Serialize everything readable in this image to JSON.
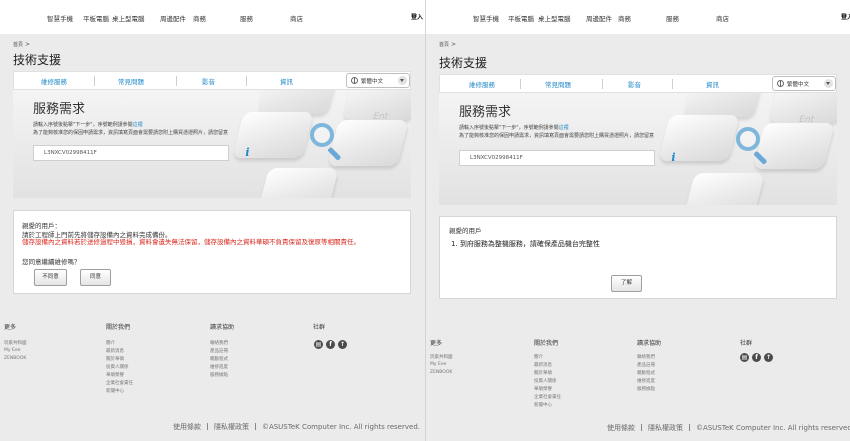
{
  "nav": {
    "items": [
      "智慧手機",
      "平板電腦",
      "桌上型電腦",
      "周邊配件",
      "商務",
      "服務",
      "商店"
    ],
    "login": "登入"
  },
  "breadcrumb": "首頁",
  "page_title": "技術支援",
  "tabs": [
    "維修服務",
    "常見問題",
    "影音",
    "資訊"
  ],
  "language": "繁體中文",
  "hero": {
    "key_label": "Ent",
    "form_title": "服務需求",
    "instruction": "請輸入序號後點擊\"下一步\"，序號範例請參閱",
    "instruction_link": "這裡",
    "note": "為了能夠核准您的保固申請需求，資訊填寫頁面會需要請您附上購買憑證照片，請您留意",
    "serial_value": "L3NXCV02998411F"
  },
  "left_notice": {
    "greeting": "親愛的用戶：",
    "line1": "請於工程師上門前先將儲存設備內之資料完成備份。",
    "warning": "儲存設備內之資料若於送修過程中毀損，資料會遺失無法保留，儲存設備內之資料華碩不負責保留及復原等相關責任。",
    "question": "您同意繼續維修嗎？",
    "disagree": "不同意",
    "agree": "同意"
  },
  "right_notice": {
    "greeting": "親愛的用戶",
    "item": "1.  到府服務為整機服務，請確保產品機台完整性",
    "ok": "了解"
  },
  "footer": {
    "col1": {
      "title": "更多",
      "links": [
        "玩家共和國",
        "My Eee",
        "ZENBOOK"
      ]
    },
    "col2": {
      "title": "關於我們",
      "links": [
        "簡介",
        "最新消息",
        "關於華碩",
        "投資人關係",
        "華碩榮譽",
        "企業社會責任",
        "新聞中心"
      ]
    },
    "col3": {
      "title": "讀求協助",
      "links": [
        "聯絡我們",
        "產品註冊",
        "驅動程式",
        "維修進度",
        "服務據點"
      ]
    },
    "col4": {
      "title": "社群"
    },
    "terms": "使用條款",
    "privacy": "隱私權政策",
    "copyright": "©ASUSTeK Computer Inc. All rights reserved."
  },
  "colors": {
    "accent": "#1e88c8",
    "warning": "#d9261c"
  }
}
